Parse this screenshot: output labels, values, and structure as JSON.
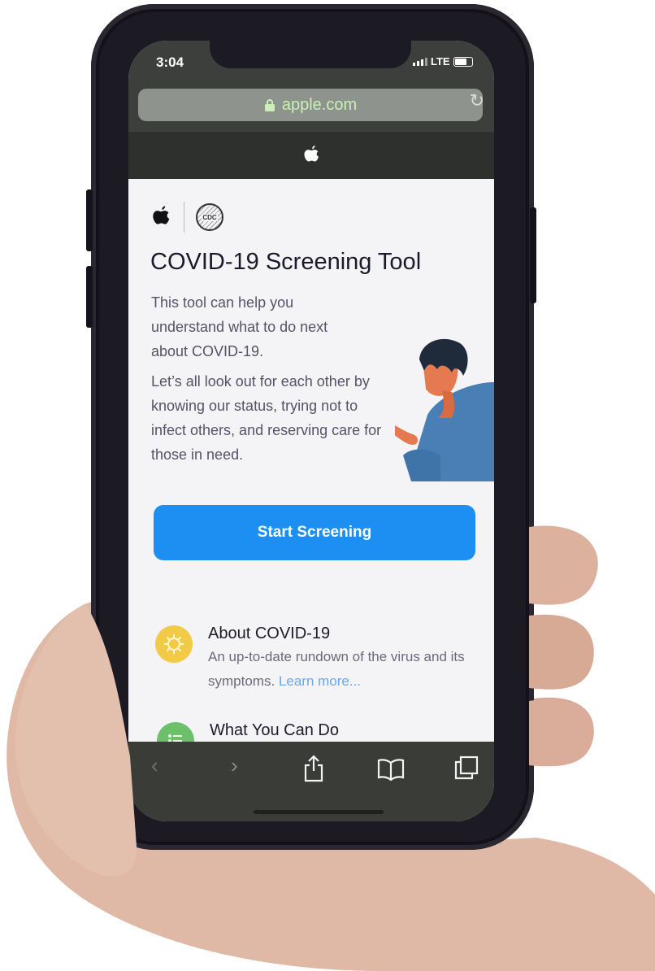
{
  "status_bar": {
    "time": "3:04",
    "network": "LTE"
  },
  "browser": {
    "url": "apple.com"
  },
  "page": {
    "title": "COVID-19 Screening Tool",
    "intro": "This tool can help you understand what to do next about COVID-19.",
    "body": "Let’s all look out for each other by knowing our status, trying not to infect others, and reserving care for those in need.",
    "cta_label": "Start Screening",
    "sections": [
      {
        "title": "About COVID-19",
        "description": "An up-to-date rundown of the virus and its symptoms.",
        "link": "Learn more...",
        "icon": "virus-icon",
        "color": "#f1cb48"
      },
      {
        "title": "What You Can Do",
        "icon": "checklist-icon",
        "color": "#6cc06a"
      }
    ]
  },
  "toolbar": {
    "icons": [
      "back-icon",
      "forward-icon",
      "share-icon",
      "bookmarks-icon",
      "tabs-icon"
    ]
  },
  "colors": {
    "accent": "#1d8ef2",
    "link": "#6fa6e6",
    "url_text": "#c9f0b8"
  }
}
